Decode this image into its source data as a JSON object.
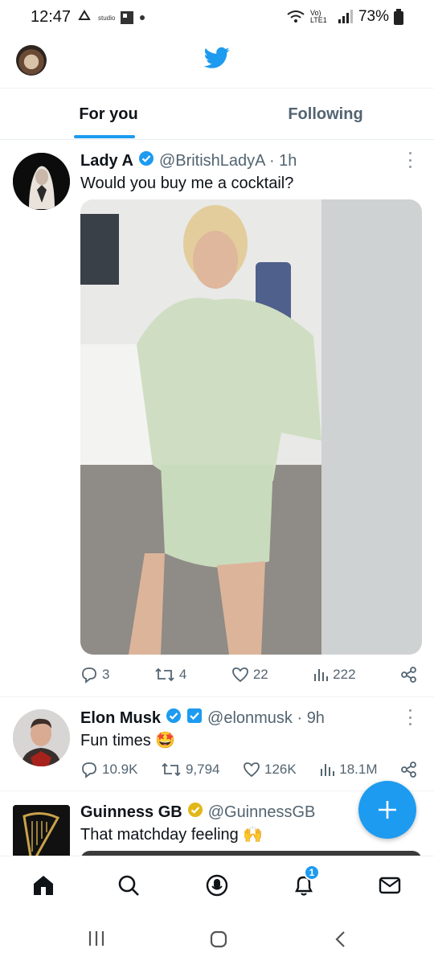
{
  "status_bar": {
    "time": "12:47",
    "studio_label": "studio",
    "network_label": "Vo) LTE1",
    "battery_percent": "73%"
  },
  "tabs": [
    {
      "label": "For you",
      "active": true
    },
    {
      "label": "Following",
      "active": false
    }
  ],
  "tweets": [
    {
      "name": "Lady A",
      "handle": "@BritishLadyA · 1h",
      "text": "Would you buy me a cocktail?",
      "replies": "3",
      "retweets": "4",
      "likes": "22",
      "views": "222",
      "verified": "blue"
    },
    {
      "name": "Elon Musk",
      "handle": "@elonmusk · 9h",
      "text": "Fun times 🤩",
      "replies": "10.9K",
      "retweets": "9,794",
      "likes": "126K",
      "views": "18.1M",
      "verified": "blue"
    },
    {
      "name": "Guinness GB",
      "handle": "@GuinnessGB",
      "text": "That matchday feeling 🙌",
      "verified": "gold"
    }
  ],
  "bottom_nav": {
    "notification_count": "1",
    "items": [
      "home-icon",
      "search-icon",
      "spaces-icon",
      "notifications-icon",
      "messages-icon"
    ]
  },
  "colors": {
    "accent": "#1d9bf0",
    "gold_badge": "#e2b719",
    "secondary_text": "#536471"
  }
}
